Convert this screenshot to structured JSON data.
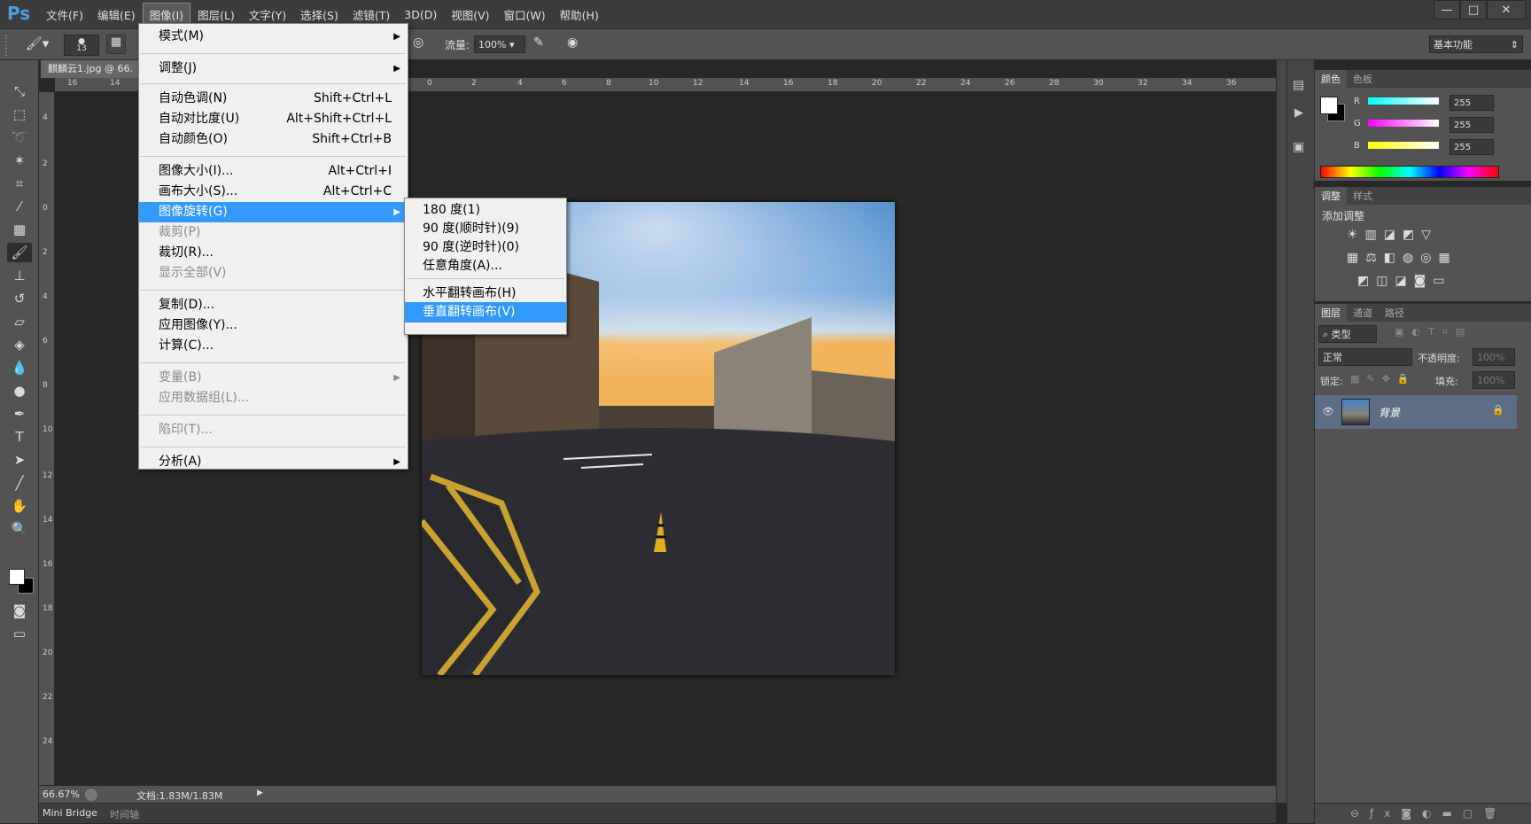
{
  "app": {
    "logo": "Ps"
  },
  "menubar": [
    "文件(F)",
    "编辑(E)",
    "图像(I)",
    "图层(L)",
    "文字(Y)",
    "选择(S)",
    "滤镜(T)",
    "3D(D)",
    "视图(V)",
    "窗口(W)",
    "帮助(H)"
  ],
  "window_controls": [
    "—",
    "□",
    "✕"
  ],
  "options": {
    "brush_size": "13",
    "flow_label": "流量:",
    "flow_value": "100%",
    "workspace": "基本功能"
  },
  "document": {
    "tab": "麒麟云1.jpg @ 66.",
    "zoom": "66.67%",
    "doc_info": "文档:1.83M/1.83M"
  },
  "ruler_h": [
    "16",
    "14",
    "0",
    "2",
    "4",
    "6",
    "8",
    "10",
    "12",
    "14",
    "16",
    "18",
    "20",
    "22",
    "24",
    "26",
    "28",
    "30",
    "32",
    "34",
    "36"
  ],
  "ruler_v": [
    "4",
    "2",
    "0",
    "2",
    "4",
    "6",
    "8",
    "10",
    "12",
    "14",
    "16",
    "18",
    "20",
    "22",
    "24"
  ],
  "bottom_tabs": [
    "Mini Bridge",
    "时间轴"
  ],
  "image_menu": {
    "items": [
      {
        "label": "模式(M)",
        "submenu": true
      },
      {
        "label": "调整(J)",
        "submenu": true
      },
      {
        "label": "自动色调(N)",
        "shortcut": "Shift+Ctrl+L"
      },
      {
        "label": "自动对比度(U)",
        "shortcut": "Alt+Shift+Ctrl+L"
      },
      {
        "label": "自动颜色(O)",
        "shortcut": "Shift+Ctrl+B"
      },
      {
        "label": "图像大小(I)...",
        "shortcut": "Alt+Ctrl+I"
      },
      {
        "label": "画布大小(S)...",
        "shortcut": "Alt+Ctrl+C"
      },
      {
        "label": "图像旋转(G)",
        "submenu": true,
        "highlight": true
      },
      {
        "label": "裁剪(P)",
        "disabled": true
      },
      {
        "label": "裁切(R)..."
      },
      {
        "label": "显示全部(V)",
        "disabled": true
      },
      {
        "label": "复制(D)..."
      },
      {
        "label": "应用图像(Y)..."
      },
      {
        "label": "计算(C)..."
      },
      {
        "label": "变量(B)",
        "submenu": true,
        "disabled": true
      },
      {
        "label": "应用数据组(L)...",
        "disabled": true
      },
      {
        "label": "陷印(T)...",
        "disabled": true
      },
      {
        "label": "分析(A)",
        "submenu": true
      }
    ]
  },
  "rotate_submenu": [
    "180 度(1)",
    "90 度(顺时针)(9)",
    "90 度(逆时针)(0)",
    "任意角度(A)...",
    "水平翻转画布(H)",
    "垂直翻转画布(V)"
  ],
  "color_panel": {
    "tabs": [
      "颜色",
      "色板"
    ],
    "r_label": "R",
    "g_label": "G",
    "b_label": "B",
    "r": "255",
    "g": "255",
    "b": "255"
  },
  "adjust_panel": {
    "tabs": [
      "调整",
      "样式"
    ],
    "title": "添加调整"
  },
  "layers_panel": {
    "tabs": [
      "图层",
      "通道",
      "路径"
    ],
    "filter": "类型",
    "blend_mode": "正常",
    "opacity_label": "不透明度:",
    "opacity": "100%",
    "lock_label": "锁定:",
    "fill_label": "填充:",
    "fill": "100%",
    "layer_name": "背景"
  },
  "colors": {
    "accent": "#3399ff",
    "menu_bg": "#f0f0f0",
    "panel": "#535353"
  }
}
